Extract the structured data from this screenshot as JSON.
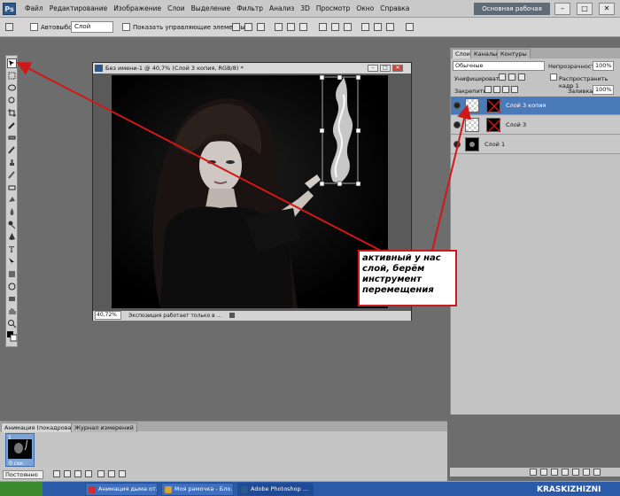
{
  "app": {
    "logo": "Ps",
    "zoom": "40,7",
    "workspace": "Основная рабочая среда",
    "window_buttons": [
      "–",
      "□",
      "✕"
    ]
  },
  "menu": [
    "Файл",
    "Редактирование",
    "Изображение",
    "Слои",
    "Выделение",
    "Фильтр",
    "Анализ",
    "3D",
    "Просмотр",
    "Окно",
    "Справка"
  ],
  "options": {
    "autoselect_label": "Автовыбор:",
    "autoselect_value": "Слой",
    "show_controls_label": "Показать управляющие элементы"
  },
  "document": {
    "title": "Без имени-1 @ 40,7% (Слой 3 копия, RGB/8) *",
    "zoom": "40,72%",
    "status": "Экспозиция работает только в ..."
  },
  "layers_panel": {
    "tabs": [
      "Слои",
      "Каналы",
      "Контуры"
    ],
    "blend_mode": "Обычные",
    "opacity_label": "Непрозрачность:",
    "opacity_value": "100%",
    "unify_label": "Унифицировать:",
    "propagate_label": "Распространить кадр 1",
    "lock_label": "Закрепить:",
    "fill_label": "Заливка:",
    "fill_value": "100%",
    "layers": [
      {
        "name": "Слой 3 копия",
        "selected": true
      },
      {
        "name": "Слой 3",
        "selected": false
      },
      {
        "name": "Слой 1",
        "selected": false
      }
    ]
  },
  "animation_panel": {
    "tabs": [
      "Анимация (покадровая)",
      "Журнал измерений"
    ],
    "frame_number": "1",
    "frame_time": "0 сек.",
    "loop": "Постоянно"
  },
  "taskbar": {
    "items": [
      "Анимация дыма от...",
      "Моя рамочка - Бло...",
      "Adobe Photoshop ..."
    ]
  },
  "annotation": {
    "text": "активный у нас слой, берём инструмент перемещения"
  },
  "watermark": "KRASKIZHIZNI",
  "colors": {
    "arrow": "#d01818",
    "selection": "#4b7ab8"
  }
}
